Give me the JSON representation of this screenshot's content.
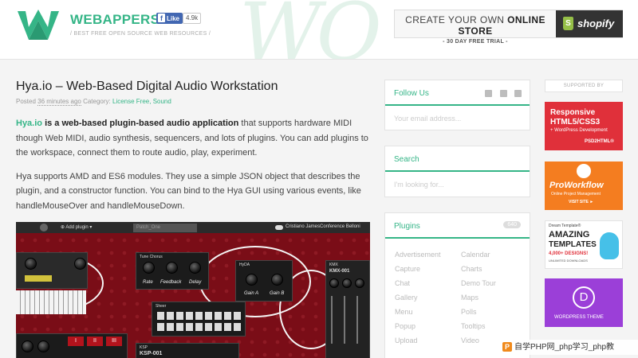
{
  "header": {
    "brand": "WEBAPPERS",
    "tagline": "/ BEST FREE OPEN SOURCE WEB RESOURCES /",
    "fb_like_label": "Like",
    "fb_count": "4.9k",
    "ad": {
      "line1_prefix": "CREATE YOUR OWN ",
      "line1_bold": "ONLINE STORE",
      "line2": "- 30 DAY FREE TRIAL -",
      "brand": "shopify"
    }
  },
  "post": {
    "title": "Hya.io – Web-Based Digital Audio Workstation",
    "meta_posted": "Posted",
    "meta_time": "36 minutes ago",
    "meta_category_label": "Category:",
    "meta_categories": "License Free, Sound",
    "p1_link": "Hya.io",
    "p1_bold": " is a web-based plugin-based audio application",
    "p1_rest": " that supports hardware MIDI though Web MIDI, audio synthesis, sequencers, and lots of plugins. You can add plugins to the workspace, connect them to route audio, play, experiment.",
    "p2": "Hya supports AMD and ES6 modules. They use a simple JSON object that describes the plugin, and a constructor function. You can bind to the Hya GUI using various events, like handleMouseOver and handleMouseDown."
  },
  "screenshot": {
    "add_plugin": "Add plugin",
    "tab": "Patch_One",
    "user": "Cristiano JamesConference Belloni",
    "tune_chorus": "Tune Chorus",
    "rate": "Rate",
    "feedback": "Feedback",
    "delay": "Delay",
    "hyda": "HyDA",
    "gain_a": "Gain A",
    "gain_b": "Gain B",
    "kmx": "KMX",
    "kmx_model": "KMX-001",
    "sheer": "Sheer",
    "ksp": "KSP",
    "ksp_model": "KSP-001",
    "roman_1": "I",
    "roman_2": "II",
    "roman_3": "III"
  },
  "sidebar": {
    "follow": {
      "title": "Follow Us",
      "placeholder": "Your email address..."
    },
    "search": {
      "title": "Search",
      "placeholder": "I'm looking for..."
    },
    "plugins": {
      "title": "Plugins",
      "count": "640",
      "col1": [
        "Advertisement",
        "Capture",
        "Chat",
        "Gallery",
        "Menu",
        "Popup",
        "Upload"
      ],
      "col2": [
        "Calendar",
        "Charts",
        "Demo Tour",
        "Maps",
        "Polls",
        "Tooltips",
        "Video"
      ]
    }
  },
  "ads": {
    "label": "SUPPORTED BY",
    "ad1": {
      "line1": "Responsive",
      "line2": "HTML5/CSS3",
      "line3": "+ WordPress Development",
      "line4": "PSD2HTML®"
    },
    "ad2": {
      "line1": "ProWorkflow",
      "line2": "Online Project Management",
      "line3": "VISIT SITE ►"
    },
    "ad3": {
      "line1": "Dream Template®",
      "line2": "AMAZING",
      "line3": "TEMPLATES",
      "line4": "4,000+ DESIGNS!",
      "line5": "UNLIMITED DOWNLOADS"
    },
    "ad4": {
      "line1": "WORDPRESS THEME"
    }
  },
  "watermark": "自学PHP网_php学习_php教"
}
